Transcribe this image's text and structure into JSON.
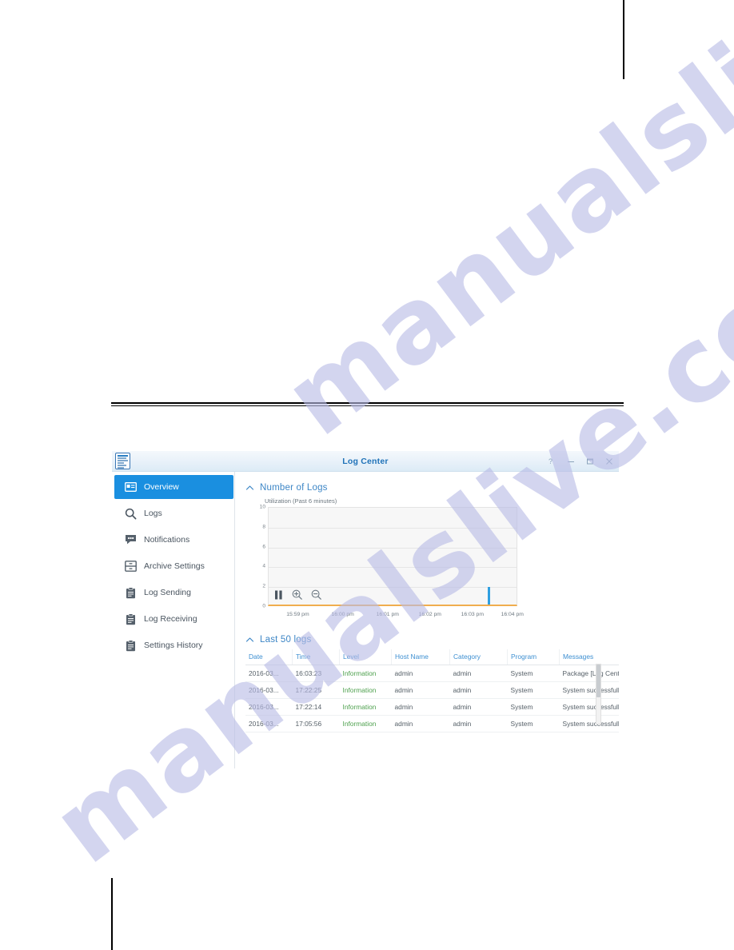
{
  "watermark": {
    "line1": "manualslive.com",
    "line2": "manualslive.com"
  },
  "window": {
    "title": "Log Center",
    "app_icon": "log-document-icon",
    "controls": [
      {
        "name": "help-button",
        "glyph": "?"
      },
      {
        "name": "minimize-button",
        "glyph": "–"
      },
      {
        "name": "maximize-button",
        "glyph": "❑"
      },
      {
        "name": "close-button",
        "glyph": "×"
      }
    ]
  },
  "sidebar": {
    "items": [
      {
        "label": "Overview",
        "icon": "overview-card-icon",
        "active": true
      },
      {
        "label": "Logs",
        "icon": "search-magnifier-icon",
        "active": false
      },
      {
        "label": "Notifications",
        "icon": "speech-bubble-icon",
        "active": false
      },
      {
        "label": "Archive Settings",
        "icon": "archive-drawer-icon",
        "active": false
      },
      {
        "label": "Log Sending",
        "icon": "clipboard-send-icon",
        "active": false
      },
      {
        "label": "Log Receiving",
        "icon": "clipboard-receive-icon",
        "active": false
      },
      {
        "label": "Settings History",
        "icon": "clipboard-history-icon",
        "active": false
      }
    ]
  },
  "content": {
    "number_of_logs": {
      "section_title": "Number of Logs",
      "collapse_icon": "chevron-up-icon",
      "chart_caption": "Utilization (Past 6 minutes)",
      "tools": [
        {
          "name": "pause-button",
          "icon": "pause-icon"
        },
        {
          "name": "zoom-in-button",
          "icon": "zoom-in-icon"
        },
        {
          "name": "zoom-out-button",
          "icon": "zoom-out-icon"
        }
      ]
    },
    "last_logs": {
      "section_title": "Last 50 logs",
      "collapse_icon": "chevron-up-icon",
      "columns": [
        "Date",
        "Time",
        "Level",
        "Host Name",
        "Category",
        "Program",
        "Messages"
      ],
      "rows": [
        [
          "2016-03...",
          "16:03:23",
          "Information",
          "admin",
          "admin",
          "System",
          "Package [Log Center] ha..."
        ],
        [
          "2016-03...",
          "17:22:25",
          "Information",
          "admin",
          "admin",
          "System",
          "System successfully dele..."
        ],
        [
          "2016-03...",
          "17:22:14",
          "Information",
          "admin",
          "admin",
          "System",
          "System successfully dele..."
        ],
        [
          "2016-03...",
          "17:05:56",
          "Information",
          "admin",
          "admin",
          "System",
          "System successfully star..."
        ]
      ]
    }
  },
  "colors": {
    "accent_blue": "#1a8fe0",
    "title_blue": "#1f72b8",
    "header_blue": "#3d8fd1",
    "level_green": "#4fa14f",
    "bar_blue": "#2f9fe0",
    "axis_orange": "#f0ad4e"
  },
  "chart_data": {
    "type": "bar",
    "title": "Utilization (Past 6 minutes)",
    "xlabel": "",
    "ylabel": "",
    "ylim": [
      0,
      10
    ],
    "yticks": [
      0,
      2,
      4,
      6,
      8,
      10
    ],
    "grid": true,
    "legend": "none",
    "categories": [
      "15:59 pm",
      "16:00 pm",
      "16:01 pm",
      "16:02 pm",
      "16:03 pm",
      "16:04 pm"
    ],
    "xtick_positions_pct": [
      12,
      30,
      48,
      65,
      82,
      98
    ],
    "points": [
      {
        "x_pct": 88.5,
        "value": 1.8
      }
    ]
  }
}
